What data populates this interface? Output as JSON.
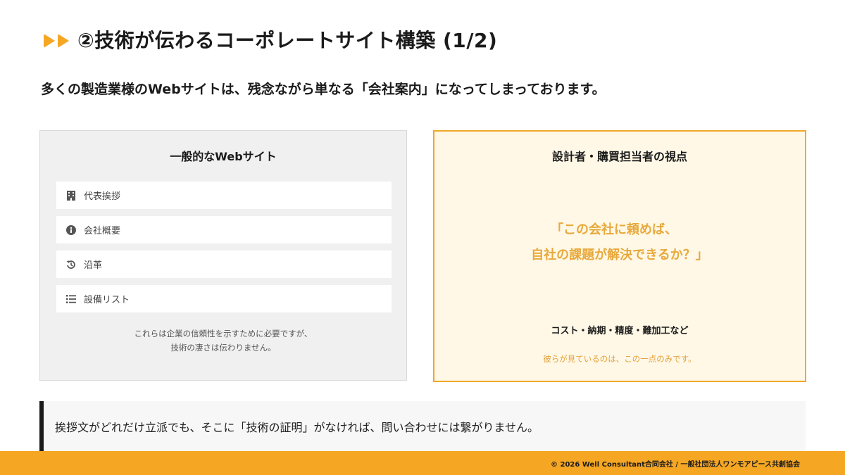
{
  "header": {
    "title": "②技術が伝わるコーポレートサイト構築 (1/2)",
    "icon": "double-arrow-icon"
  },
  "lead": "多くの製造業様のWebサイトは、残念ながら単なる「会社案内」になってしまっております。",
  "left_panel": {
    "title": "一般的なWebサイト",
    "items": [
      {
        "label": "代表挨拶",
        "icon": "building-icon"
      },
      {
        "label": "会社概要",
        "icon": "info-icon"
      },
      {
        "label": "沿革",
        "icon": "history-icon"
      },
      {
        "label": "設備リスト",
        "icon": "list-icon"
      }
    ],
    "note_line1": "これらは企業の信頼性を示すために必要ですが、",
    "note_line2": "技術の凄さは伝わりません。"
  },
  "right_panel": {
    "title": "設計者・購買担当者の視点",
    "quote_line1": "「この会社に頼めば、",
    "quote_line2": "自社の課題が解決できるか？」",
    "factors": "コスト・納期・精度・難加工など",
    "focus_note": "彼らが見ているのは、この一点のみです。"
  },
  "callout": "挨拶文がどれだけ立派でも、そこに「技術の証明」がなければ、問い合わせには繋がりません。",
  "footer": "© 2026 Well Consultant合同会社 / 一般社団法人ワンモアピース共創協会",
  "colors": {
    "accent": "#f5a623",
    "quote": "#e8a93c",
    "panel_gray": "#f0f0f0",
    "panel_cream": "#fff8e6"
  }
}
